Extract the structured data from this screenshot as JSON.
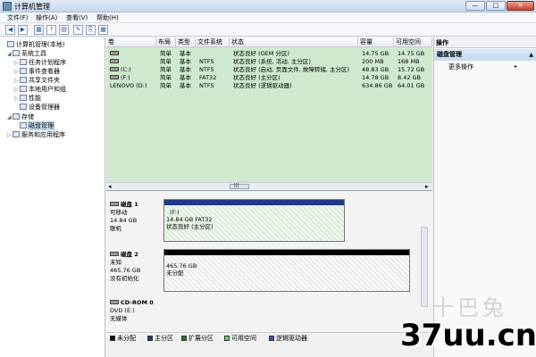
{
  "window": {
    "title": "计算机管理",
    "min": "—",
    "max": "□",
    "close": "✕"
  },
  "menu": [
    "文件(F)",
    "操作(A)",
    "查看(V)",
    "帮助(H)"
  ],
  "toolbar": [
    "◀",
    "▶",
    "▦",
    "?",
    "▤",
    "✎",
    "⎘",
    "▦"
  ],
  "tree": [
    {
      "label": "计算机管理(本地)",
      "twisty": "",
      "indent": 0
    },
    {
      "label": "系统工具",
      "twisty": "◢",
      "indent": 1
    },
    {
      "label": "任务计划程序",
      "twisty": "▷",
      "indent": 2
    },
    {
      "label": "事件查看器",
      "twisty": "▷",
      "indent": 2
    },
    {
      "label": "共享文件夹",
      "twisty": "▷",
      "indent": 2
    },
    {
      "label": "本地用户和组",
      "twisty": "▷",
      "indent": 2
    },
    {
      "label": "性能",
      "twisty": "▷",
      "indent": 2
    },
    {
      "label": "设备管理器",
      "twisty": "",
      "indent": 2
    },
    {
      "label": "存储",
      "twisty": "◢",
      "indent": 1
    },
    {
      "label": "磁盘管理",
      "twisty": "",
      "indent": 2,
      "selected": true
    },
    {
      "label": "服务和应用程序",
      "twisty": "▷",
      "indent": 1
    }
  ],
  "volume_table": {
    "columns": [
      "卷",
      "布局",
      "类型",
      "文件系统",
      "状态",
      "容量",
      "可用空间"
    ],
    "rows": [
      [
        "",
        "简单",
        "基本",
        "",
        "状态良好 (OEM 分区)",
        "14.75 GB",
        "14.75 GB"
      ],
      [
        "",
        "简单",
        "基本",
        "NTFS",
        "状态良好 (系统, 活动, 主分区)",
        "200 MB",
        "168 MB"
      ],
      [
        "(C:)",
        "简单",
        "基本",
        "NTFS",
        "状态良好 (启动, 页面文件, 故障转储, 主分区)",
        "48.83 GB",
        "15.72 GB"
      ],
      [
        "(F:)",
        "简单",
        "基本",
        "FAT32",
        "状态良好 (主分区)",
        "14.78 GB",
        "8.42 GB"
      ],
      [
        "LENOVO (D:)",
        "简单",
        "基本",
        "NTFS",
        "状态良好 (逻辑驱动器)",
        "634.86 GB",
        "64.01 GB"
      ]
    ],
    "scroll_left": "◂",
    "scroll_right": "▸",
    "scroll_grip": "|||"
  },
  "disks": [
    {
      "name": "磁盘 1",
      "type": "可移动",
      "size": "14.84 GB",
      "status": "联机",
      "partition": {
        "label": "(F:)",
        "detail": "14.84 GB FAT32",
        "status": "状态良好 (主分区)"
      }
    },
    {
      "name": "磁盘 2",
      "type": "未知",
      "size": "465.76 GB",
      "status": "没有初始化",
      "partition": {
        "label": "465.76 GB",
        "detail": "未分配"
      }
    },
    {
      "name": "CD-ROM 0",
      "type": "DVD (E:)",
      "size": "",
      "status": "无媒体"
    }
  ],
  "legend": [
    {
      "label": "未分配",
      "color": "#000000"
    },
    {
      "label": "主分区",
      "color": "#1f3a8a"
    },
    {
      "label": "扩展分区",
      "color": "#2f7a2f"
    },
    {
      "label": "可用空间",
      "color": "#5fd35f"
    },
    {
      "label": "逻辑驱动器",
      "color": "#3a4fc0"
    }
  ],
  "actions": {
    "header": "操作",
    "selected": "磁盘管理",
    "more": "更多操作",
    "more_arrow": "▸",
    "sel_arrow": "▲"
  },
  "watermarks": {
    "brand": "十巴兔",
    "site": "37uu.cn"
  }
}
